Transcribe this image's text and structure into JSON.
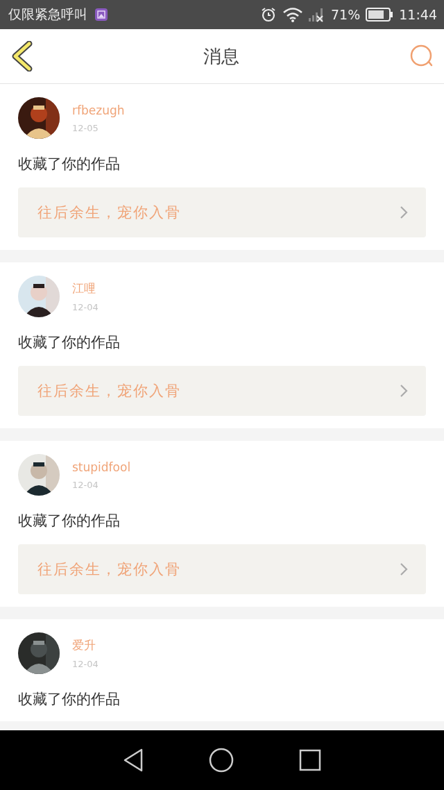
{
  "status_bar": {
    "carrier": "仅限紧急呼叫",
    "battery_text": "71%",
    "time": "11:44"
  },
  "header": {
    "title": "消息"
  },
  "messages": [
    {
      "username": "rfbezugh",
      "date": "12-05",
      "action": "收藏了你的作品",
      "work_title": "往后余生，宠你入骨"
    },
    {
      "username": "江哩",
      "date": "12-04",
      "action": "收藏了你的作品",
      "work_title": "往后余生，宠你入骨"
    },
    {
      "username": "stupidfool",
      "date": "12-04",
      "action": "收藏了你的作品",
      "work_title": "往后余生，宠你入骨"
    },
    {
      "username": "爱升",
      "date": "12-04",
      "action": "收藏了你的作品"
    }
  ]
}
